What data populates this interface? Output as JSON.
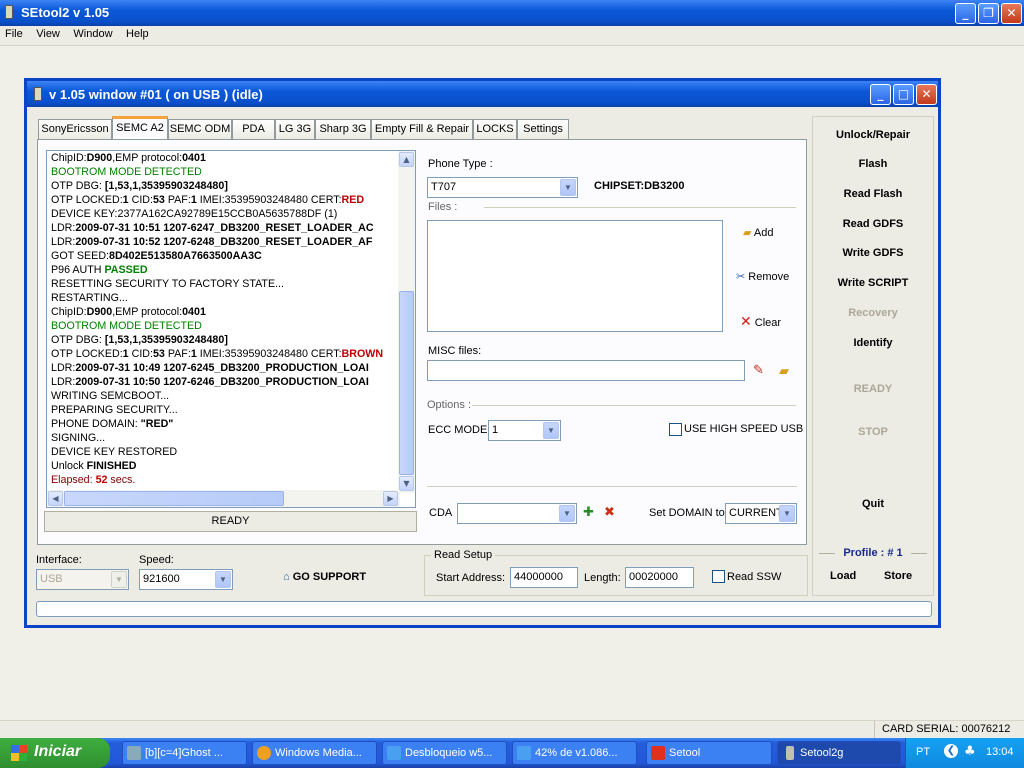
{
  "app": {
    "title": "SEtool2 v 1.05",
    "menu": [
      "File",
      "View",
      "Window",
      "Help"
    ]
  },
  "window": {
    "title": "v 1.05 window #01 ( on USB ) (idle)"
  },
  "tabs": [
    "SonyEricsson",
    "SEMC A2",
    "SEMC ODM",
    "PDA",
    "LG 3G",
    "Sharp 3G",
    "Empty Fill & Repair",
    "LOCKS",
    "Settings"
  ],
  "selected_tab": "SEMC A2",
  "log": [
    {
      "p": "ChipID:",
      "b": "D900",
      "s": ",EMP protocol:",
      "b2": "0401"
    },
    {
      "p": "BOOTROM MODE DETECTED",
      "color": "#008000"
    },
    {
      "p": "OTP DBG: ",
      "b": "[1,53,1,35395903248480]"
    },
    {
      "p": "OTP LOCKED:",
      "b": "1",
      "s": " CID:",
      "b2": "53",
      "s2": " PAF:",
      "b3": "1",
      "s3": " IMEI:35395903248480 CERT:",
      "r": "RED"
    },
    {
      "p": "DEVICE KEY:2377A162CA92789E15CCB0A5635788DF (1)"
    },
    {
      "p": "LDR:",
      "b": "2009-07-31 10:51 1207-6247_DB3200_RESET_LOADER_AC"
    },
    {
      "p": "LDR:",
      "b": "2009-07-31 10:52 1207-6248_DB3200_RESET_LOADER_AF"
    },
    {
      "p": "GOT SEED:",
      "b": "8D402E513580A7663500AA3C"
    },
    {
      "p": "P96 AUTH ",
      "g": "PASSED"
    },
    {
      "p": "RESETTING SECURITY TO FACTORY STATE..."
    },
    {
      "p": "RESTARTING..."
    },
    {
      "p": "ChipID:",
      "b": "D900",
      "s": ",EMP protocol:",
      "b2": "0401"
    },
    {
      "p": "BOOTROM MODE DETECTED",
      "color": "#008000"
    },
    {
      "p": "OTP DBG: ",
      "b": "[1,53,1,35395903248480]"
    },
    {
      "p": "OTP LOCKED:",
      "b": "1",
      "s": " CID:",
      "b2": "53",
      "s2": " PAF:",
      "b3": "1",
      "s3": " IMEI:35395903248480 CERT:",
      "r": "BROWN"
    },
    {
      "p": "LDR:",
      "b": "2009-07-31 10:49 1207-6245_DB3200_PRODUCTION_LOAI"
    },
    {
      "p": "LDR:",
      "b": "2009-07-31 10:50 1207-6246_DB3200_PRODUCTION_LOAI"
    },
    {
      "p": "WRITING SEMCBOOT..."
    },
    {
      "p": "PREPARING SECURITY..."
    },
    {
      "p": "PHONE DOMAIN: ",
      "b": "\"RED\""
    },
    {
      "p": "SIGNING..."
    },
    {
      "p": "DEVICE KEY RESTORED"
    },
    {
      "p": "Unlock ",
      "b": "FINISHED"
    },
    {
      "p": "Elapsed: ",
      "r": "52",
      "s": " secs.",
      "color": "#800000"
    }
  ],
  "status": "READY",
  "phone": {
    "label": "Phone Type :",
    "value": "T707",
    "chipset": "CHIPSET:DB3200"
  },
  "files": {
    "label": "Files :",
    "add": "Add",
    "remove": "Remove",
    "clear": "Clear"
  },
  "misc": {
    "label": "MISC files:"
  },
  "options": {
    "label": "Options :",
    "ecc_label": "ECC MODE",
    "ecc_value": "1",
    "high_speed": "USE HIGH SPEED USB"
  },
  "cda": {
    "label": "CDA",
    "domain_label": "Set DOMAIN to",
    "domain_value": "CURRENT"
  },
  "actions": [
    {
      "label": "Unlock/Repair",
      "enabled": true
    },
    {
      "label": "Flash",
      "enabled": true
    },
    {
      "label": "Read Flash",
      "enabled": true
    },
    {
      "label": "Read GDFS",
      "enabled": true
    },
    {
      "label": "Write GDFS",
      "enabled": true
    },
    {
      "label": "Write SCRIPT",
      "enabled": true
    },
    {
      "label": "Recovery",
      "enabled": false
    },
    {
      "label": "Identify",
      "enabled": true
    }
  ],
  "ready_label": "READY",
  "stop_label": "STOP",
  "quit_label": "Quit",
  "profile": {
    "label": "Profile : # 1",
    "load": "Load",
    "store": "Store"
  },
  "interface": {
    "label": "Interface:",
    "value": "USB"
  },
  "speed": {
    "label": "Speed:",
    "value": "921600"
  },
  "go_support": "GO SUPPORT",
  "read_setup": {
    "label": "Read Setup",
    "start_label": "Start Address:",
    "start_value": "44000000",
    "length_label": "Length:",
    "length_value": "00020000",
    "ssw": "Read SSW"
  },
  "card_serial": "CARD SERIAL: 00076212",
  "taskbar": {
    "start": "Iniciar",
    "tasks": [
      "[b][c=4]Ghost ...",
      "Windows Media...",
      "Desbloqueio w5...",
      "42% de v1.086...",
      "Setool",
      "Setool2g"
    ],
    "lang": "PT",
    "clock": "13:04"
  }
}
